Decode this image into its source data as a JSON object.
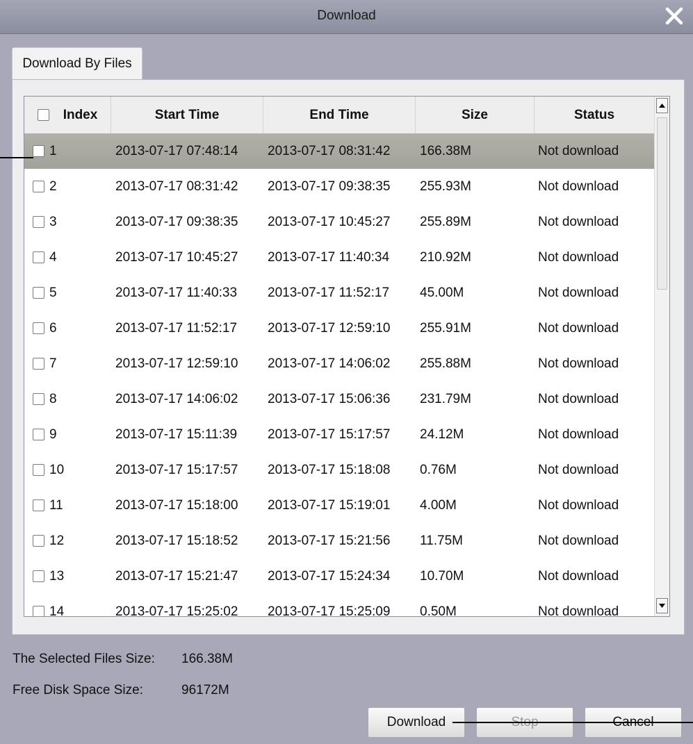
{
  "window": {
    "title": "Download",
    "close_icon": "close-icon"
  },
  "tabs": [
    {
      "label": "Download By Files"
    }
  ],
  "table": {
    "columns": [
      "Index",
      "Start Time",
      "End Time",
      "Size",
      "Status"
    ],
    "rows": [
      {
        "index": "1",
        "start": "2013-07-17 07:48:14",
        "end": "2013-07-17 08:31:42",
        "size": "166.38M",
        "status": "Not download",
        "selected": true
      },
      {
        "index": "2",
        "start": "2013-07-17 08:31:42",
        "end": "2013-07-17 09:38:35",
        "size": "255.93M",
        "status": "Not download"
      },
      {
        "index": "3",
        "start": "2013-07-17 09:38:35",
        "end": "2013-07-17 10:45:27",
        "size": "255.89M",
        "status": "Not download"
      },
      {
        "index": "4",
        "start": "2013-07-17 10:45:27",
        "end": "2013-07-17 11:40:34",
        "size": "210.92M",
        "status": "Not download"
      },
      {
        "index": "5",
        "start": "2013-07-17 11:40:33",
        "end": "2013-07-17 11:52:17",
        "size": "45.00M",
        "status": "Not download"
      },
      {
        "index": "6",
        "start": "2013-07-17 11:52:17",
        "end": "2013-07-17 12:59:10",
        "size": "255.91M",
        "status": "Not download"
      },
      {
        "index": "7",
        "start": "2013-07-17 12:59:10",
        "end": "2013-07-17 14:06:02",
        "size": "255.88M",
        "status": "Not download"
      },
      {
        "index": "8",
        "start": "2013-07-17 14:06:02",
        "end": "2013-07-17 15:06:36",
        "size": "231.79M",
        "status": "Not download"
      },
      {
        "index": "9",
        "start": "2013-07-17 15:11:39",
        "end": "2013-07-17 15:17:57",
        "size": "24.12M",
        "status": "Not download"
      },
      {
        "index": "10",
        "start": "2013-07-17 15:17:57",
        "end": "2013-07-17 15:18:08",
        "size": "0.76M",
        "status": "Not download"
      },
      {
        "index": "11",
        "start": "2013-07-17 15:18:00",
        "end": "2013-07-17 15:19:01",
        "size": "4.00M",
        "status": "Not download"
      },
      {
        "index": "12",
        "start": "2013-07-17 15:18:52",
        "end": "2013-07-17 15:21:56",
        "size": "11.75M",
        "status": "Not download"
      },
      {
        "index": "13",
        "start": "2013-07-17 15:21:47",
        "end": "2013-07-17 15:24:34",
        "size": "10.70M",
        "status": "Not download"
      },
      {
        "index": "14",
        "start": "2013-07-17 15:25:02",
        "end": "2013-07-17 15:25:09",
        "size": "0.50M",
        "status": "Not download"
      }
    ]
  },
  "info": {
    "selected_size_label": "The Selected Files Size:",
    "selected_size_value": "166.38M",
    "free_space_label": "Free Disk Space Size:",
    "free_space_value": "96172M"
  },
  "buttons": {
    "download": "Download",
    "stop": "Stop",
    "cancel": "Cancel"
  },
  "colors": {
    "selected_row": "#a8a8a0",
    "background": "#a8a8b8"
  }
}
